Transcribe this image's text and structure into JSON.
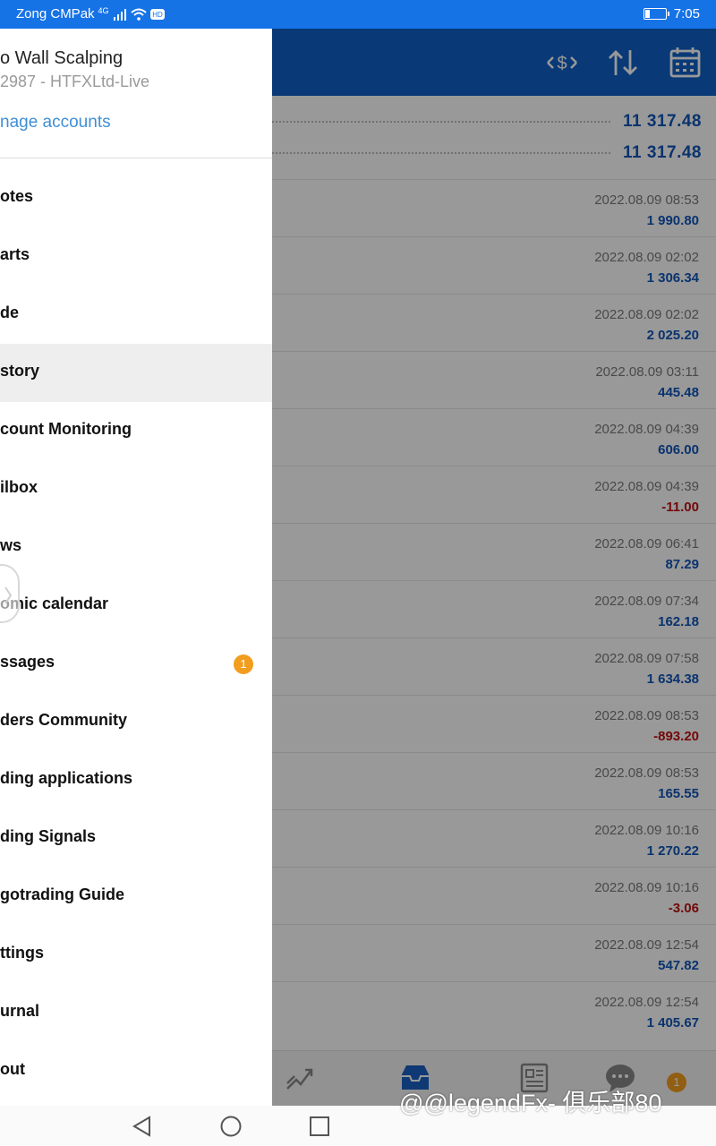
{
  "status_bar": {
    "carrier": "Zong CMPak",
    "network": "4G",
    "time": "7:05"
  },
  "summary": {
    "rows": [
      {
        "value": "11 317.48"
      },
      {
        "value": "11 317.48"
      }
    ]
  },
  "history": {
    "rows": [
      {
        "date": "2022.08.09 08:53",
        "amount": "1 990.80",
        "negative": false
      },
      {
        "date": "2022.08.09 02:02",
        "amount": "1 306.34",
        "negative": false
      },
      {
        "date": "2022.08.09 02:02",
        "amount": "2 025.20",
        "negative": false
      },
      {
        "date": "2022.08.09 03:11",
        "amount": "445.48",
        "negative": false
      },
      {
        "date": "2022.08.09 04:39",
        "amount": "606.00",
        "negative": false
      },
      {
        "date": "2022.08.09 04:39",
        "amount": "-11.00",
        "negative": true
      },
      {
        "date": "2022.08.09 06:41",
        "amount": "87.29",
        "negative": false
      },
      {
        "date": "2022.08.09 07:34",
        "amount": "162.18",
        "negative": false
      },
      {
        "date": "2022.08.09 07:58",
        "amount": "1 634.38",
        "negative": false
      },
      {
        "date": "2022.08.09 08:53",
        "amount": "-893.20",
        "negative": true
      },
      {
        "date": "2022.08.09 08:53",
        "amount": "165.55",
        "negative": false
      },
      {
        "date": "2022.08.09 10:16",
        "amount": "1 270.22",
        "negative": false
      },
      {
        "date": "2022.08.09 10:16",
        "amount": "-3.06",
        "negative": true
      },
      {
        "date": "2022.08.09 12:54",
        "amount": "547.82",
        "negative": false
      },
      {
        "date": "2022.08.09 12:54",
        "amount": "1 405.67",
        "negative": false
      }
    ]
  },
  "drawer": {
    "account_name": "o Wall Scalping",
    "account_server": "2987 - HTFXLtd-Live",
    "manage_accounts": "nage accounts",
    "items": [
      {
        "label": "otes"
      },
      {
        "label": "arts"
      },
      {
        "label": "de"
      },
      {
        "label": "story",
        "active": true
      },
      {
        "label": "count Monitoring"
      },
      {
        "label": "ilbox"
      },
      {
        "label": "ws"
      },
      {
        "label": "omic calendar"
      },
      {
        "label": "ssages",
        "badge": "1"
      },
      {
        "label": "ders Community"
      },
      {
        "label": "ding applications"
      },
      {
        "label": "ding Signals"
      },
      {
        "label": "gotrading Guide"
      },
      {
        "label": "ttings"
      },
      {
        "label": "urnal"
      },
      {
        "label": "out"
      }
    ]
  },
  "bottom_nav": {
    "messages_badge": "1"
  },
  "watermark": "@@legendFx- 俱乐部80",
  "colors": {
    "status_bar": "#1673e6",
    "app_bar": "#0f5fc6",
    "positive_amount": "#1155b8",
    "negative_amount": "#c01010",
    "badge": "#f29d1e",
    "link": "#3f8fd6"
  }
}
